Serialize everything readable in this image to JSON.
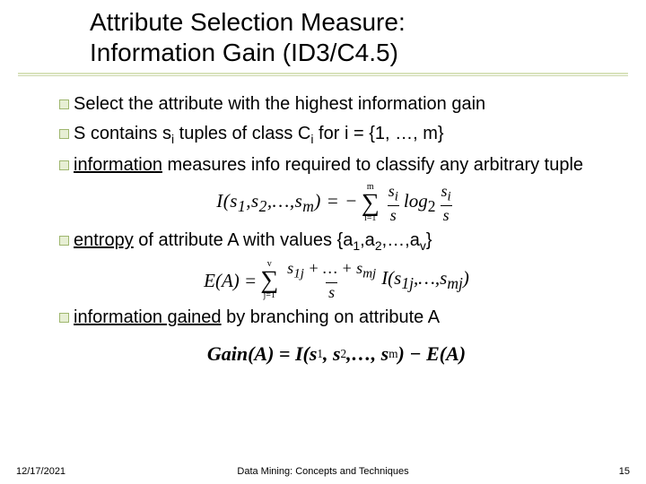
{
  "title_line1": "Attribute Selection Measure:",
  "title_line2": "Information Gain (ID3/C4.5)",
  "bullets": {
    "b1": "Select the attribute with the highest information gain",
    "b2_pre": "S contains s",
    "b2_sub1": "i",
    "b2_mid": " tuples of class C",
    "b2_sub2": "i",
    "b2_post": " for i = {1, …, m}",
    "b3a": "information",
    "b3b": " measures info required to classify any arbitrary tuple",
    "b4a": "entropy",
    "b4b": " of attribute A with values {a",
    "b4s1": "1",
    "b4c": ",a",
    "b4s2": "2",
    "b4d": ",…,a",
    "b4s3": "v",
    "b4e": "}",
    "b5a": "information gained",
    "b5b": " by branching on attribute A"
  },
  "eq1": {
    "lhs": "I(s",
    "lhs_s1": "1",
    "lhs_m": ",s",
    "lhs_s2": "2",
    "lhs_r": ",…,s",
    "lhs_sm": "m",
    "lhs_end": ") = −",
    "sum_top": "m",
    "sum_bot": "i=1",
    "frac1_num": "s",
    "frac1_num_sub": "i",
    "frac1_den": "s",
    "log": "log",
    "log_sub": "2",
    "frac2_num": "s",
    "frac2_num_sub": "i",
    "frac2_den": "s"
  },
  "eq2": {
    "lhs": "E(A) = ",
    "sum_top": "v",
    "sum_bot": "j=1",
    "num_a": "s",
    "num_a_sub": "1j",
    "num_plus": " + … + ",
    "num_b": "s",
    "num_b_sub": "mj",
    "den": "s",
    "rhs_I": "I(s",
    "rhs_s1": "1j",
    "rhs_m": ",…,s",
    "rhs_sm": "mj",
    "rhs_end": ")"
  },
  "eq3": {
    "lhs": "Gain(A) = I(s",
    "s1": "1",
    "m1": ", s",
    "s2": "2",
    "m2": ",…, s",
    "sm": "m",
    "r": ") − E(A)"
  },
  "footer": {
    "date": "12/17/2021",
    "center": "Data Mining: Concepts and Techniques",
    "page": "15"
  }
}
